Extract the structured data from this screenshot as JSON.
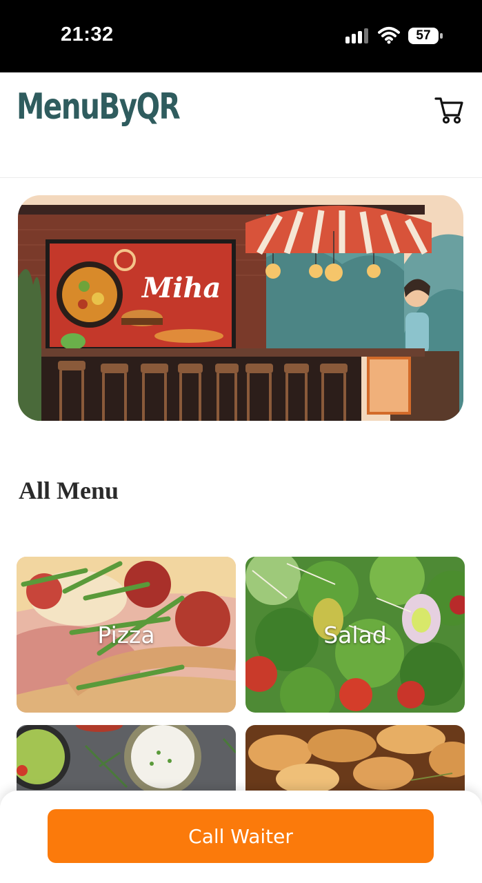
{
  "status_bar": {
    "time": "21:32",
    "battery": "57"
  },
  "header": {
    "brand": "MenuByQR",
    "cart_icon": "cart-icon"
  },
  "banner": {
    "sign_text": "Miha"
  },
  "menu": {
    "title": "All Menu",
    "categories": [
      {
        "label": "Pizza"
      },
      {
        "label": "Salad"
      },
      {
        "label": ""
      },
      {
        "label": ""
      }
    ]
  },
  "actions": {
    "call_waiter_label": "Call Waiter"
  },
  "colors": {
    "accent": "#fb7a0b",
    "brand": "#2f5c5e"
  }
}
